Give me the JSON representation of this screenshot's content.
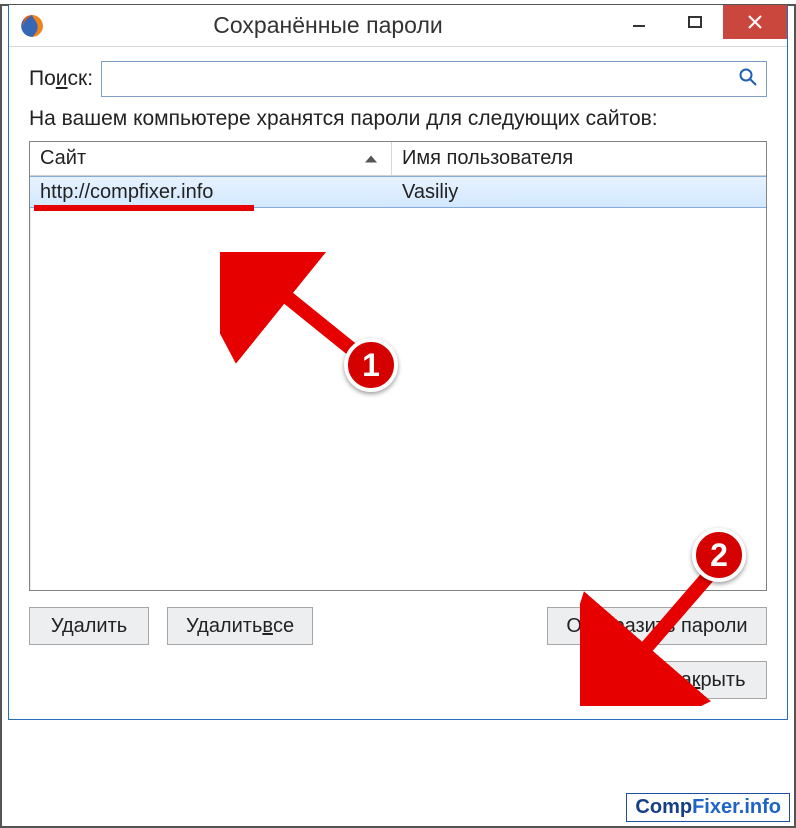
{
  "window": {
    "title": "Сохранённые пароли"
  },
  "search": {
    "label_pre": "По",
    "label_u": "и",
    "label_post": "ск:",
    "value": ""
  },
  "info": "На вашем компьютере хранятся пароли для следующих сайтов:",
  "columns": {
    "site": "Сайт",
    "user": "Имя пользователя"
  },
  "rows": [
    {
      "site": "http://compfixer.info",
      "user": "Vasiliy"
    }
  ],
  "buttons": {
    "delete": "Удалить",
    "delete_all_pre": "Удалить ",
    "delete_all_u": "в",
    "delete_all_post": "се",
    "show_passwords": "Отобразить пароли",
    "close_pre": "За",
    "close_u": "к",
    "close_post": "рыть"
  },
  "annotations": {
    "badge1": "1",
    "badge2": "2"
  },
  "watermark": {
    "part1": "Comp",
    "part2": "Fixer.info"
  }
}
